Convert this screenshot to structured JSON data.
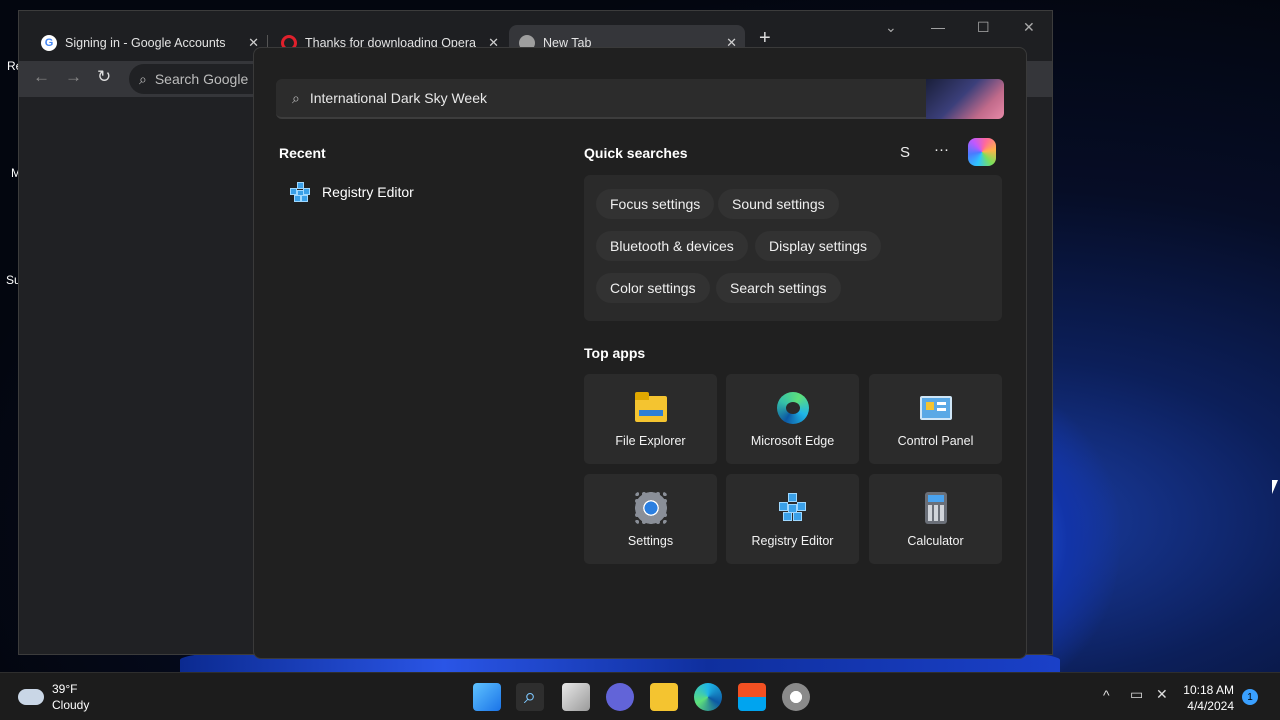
{
  "desktop": {
    "labels": [
      "Re",
      "M",
      "Su"
    ]
  },
  "browser": {
    "tabs": [
      {
        "title": "Signing in - Google Accounts",
        "close": "✕"
      },
      {
        "title": "Thanks for downloading Opera",
        "close": "✕"
      },
      {
        "title": "New Tab",
        "close": "✕"
      }
    ],
    "new_tab": "+",
    "window_controls": [
      "⌄",
      "—",
      "☐",
      "✕"
    ],
    "omnibox_placeholder": "Search Google"
  },
  "search": {
    "query": "International Dark Sky Week",
    "recent_title": "Recent",
    "recent_items": [
      {
        "label": "Registry Editor",
        "icon": "registry-editor-icon"
      }
    ],
    "quick_title": "Quick searches",
    "profile_initial": "S",
    "more": "···",
    "quick_chips": [
      "Focus settings",
      "Sound settings",
      "Bluetooth & devices",
      "Display settings",
      "Color settings",
      "Search settings"
    ],
    "top_apps_title": "Top apps",
    "top_apps": [
      {
        "label": "File Explorer",
        "icon": "file-explorer-icon"
      },
      {
        "label": "Microsoft Edge",
        "icon": "edge-icon"
      },
      {
        "label": "Control Panel",
        "icon": "control-panel-icon"
      },
      {
        "label": "Settings",
        "icon": "settings-gear-icon"
      },
      {
        "label": "Registry Editor",
        "icon": "registry-editor-icon"
      },
      {
        "label": "Calculator",
        "icon": "calculator-icon"
      }
    ]
  },
  "taskbar": {
    "weather_temp": "39°F",
    "weather_desc": "Cloudy",
    "time": "10:18 AM",
    "date": "4/4/2024",
    "notifications": "1",
    "tray_chevron": "^"
  }
}
